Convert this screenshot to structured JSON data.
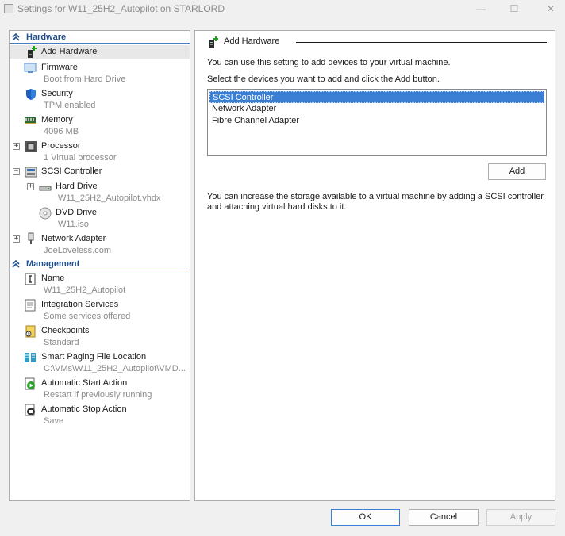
{
  "window": {
    "title": "Settings for W11_25H2_Autopilot on STARLORD",
    "minimize": "—",
    "maximize": "☐",
    "close": "✕"
  },
  "hardware_section": {
    "label": "Hardware",
    "items": [
      {
        "label": "Add Hardware",
        "sub": "",
        "icon": "add-hardware-icon"
      },
      {
        "label": "Firmware",
        "sub": "Boot from Hard Drive",
        "icon": "firmware-icon"
      },
      {
        "label": "Security",
        "sub": "TPM enabled",
        "icon": "shield-icon"
      },
      {
        "label": "Memory",
        "sub": "4096 MB",
        "icon": "memory-icon"
      },
      {
        "label": "Processor",
        "sub": "1 Virtual processor",
        "icon": "processor-icon"
      },
      {
        "label": "SCSI Controller",
        "sub": "",
        "icon": "scsi-controller-icon"
      },
      {
        "label": "Hard Drive",
        "sub": "W11_25H2_Autopilot.vhdx",
        "icon": "hard-drive-icon"
      },
      {
        "label": "DVD Drive",
        "sub": "W11.iso",
        "icon": "dvd-icon"
      },
      {
        "label": "Network Adapter",
        "sub": "JoeLoveless.com",
        "icon": "network-adapter-icon"
      }
    ]
  },
  "management_section": {
    "label": "Management",
    "items": [
      {
        "label": "Name",
        "sub": "W11_25H2_Autopilot",
        "icon": "name-icon"
      },
      {
        "label": "Integration Services",
        "sub": "Some services offered",
        "icon": "integration-services-icon"
      },
      {
        "label": "Checkpoints",
        "sub": "Standard",
        "icon": "checkpoints-icon"
      },
      {
        "label": "Smart Paging File Location",
        "sub": "C:\\VMs\\W11_25H2_Autopilot\\VMD...",
        "icon": "smart-paging-icon"
      },
      {
        "label": "Automatic Start Action",
        "sub": "Restart if previously running",
        "icon": "auto-start-icon"
      },
      {
        "label": "Automatic Stop Action",
        "sub": "Save",
        "icon": "auto-stop-icon"
      }
    ]
  },
  "expanders": {
    "processor": "+",
    "scsi": "−",
    "hard_drive": "+",
    "network": "+"
  },
  "panel": {
    "title": "Add Hardware",
    "intro": "You can use this setting to add devices to your virtual machine.",
    "instruction": "Select the devices you want to add and click the Add button.",
    "devices": [
      "SCSI Controller",
      "Network Adapter",
      "Fibre Channel Adapter"
    ],
    "selected_device": "SCSI Controller",
    "add_button": "Add",
    "storage_note": "You can increase the storage available to a virtual machine by adding a SCSI controller and attaching virtual hard disks to it."
  },
  "footer": {
    "ok": "OK",
    "cancel": "Cancel",
    "apply": "Apply"
  },
  "colors": {
    "accent": "#3b7fd4",
    "section_header": "#1f4e8c",
    "subtext": "#8a8a8a"
  }
}
